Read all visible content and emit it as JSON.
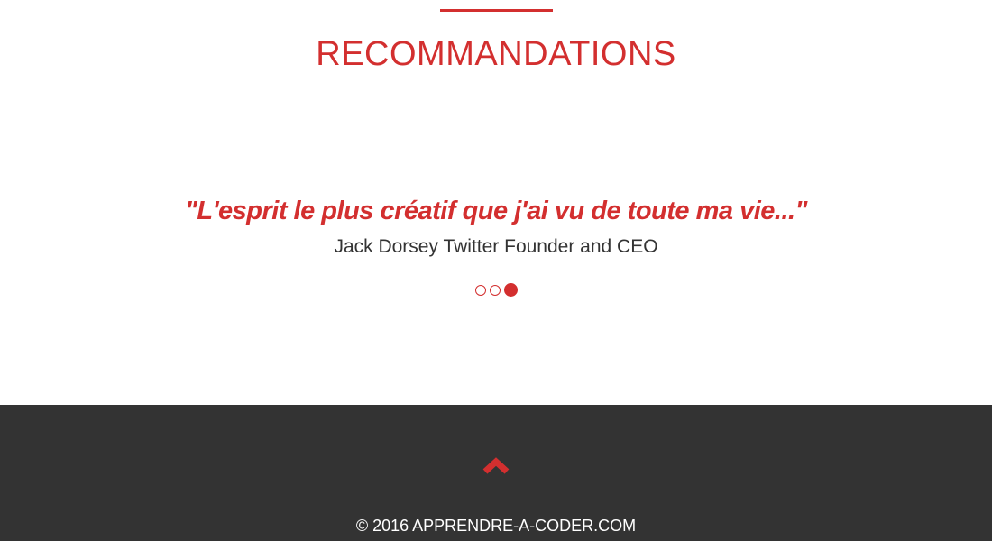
{
  "recommendations": {
    "title": "RECOMMANDATIONS",
    "quote": "\"L'esprit le plus créatif que j'ai vu de toute ma vie...\"",
    "author": "Jack Dorsey Twitter Founder and CEO",
    "carousel": {
      "slide_count": 3,
      "active_index": 2
    }
  },
  "footer": {
    "back_to_top_icon": "chevron-up-icon",
    "copyright": "© 2016 APPRENDRE-A-CODER.COM"
  },
  "colors": {
    "accent": "#d32f2f",
    "footer_bg": "#333333",
    "text_dark": "#333333",
    "footer_text": "#ffffff"
  }
}
